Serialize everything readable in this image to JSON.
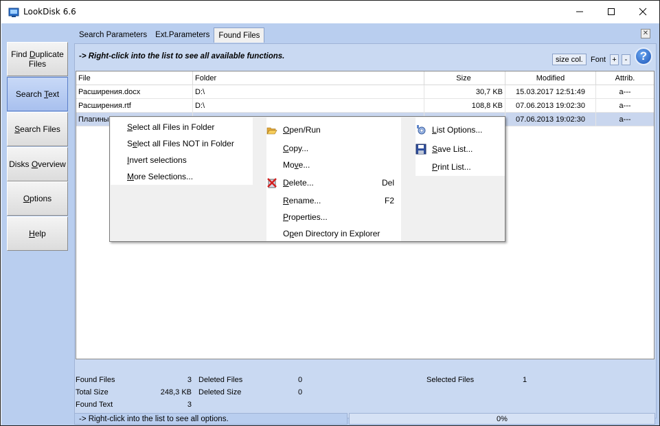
{
  "window": {
    "title": "LookDisk 6.6",
    "controls": {
      "minimize": "—",
      "maximize": "☐",
      "close": "✕"
    }
  },
  "sidebar": {
    "buttons": [
      {
        "label": "Find Duplicate Files",
        "pre": "Find ",
        "u": "D",
        "post": "uplicate Files"
      },
      {
        "label": "Search Text",
        "pre": "Search ",
        "u": "T",
        "post": "ext",
        "active": true
      },
      {
        "label": "Search Files",
        "pre": "",
        "u": "S",
        "post": "earch Files"
      },
      {
        "label": "Disks Overview",
        "pre": "Disks ",
        "u": "O",
        "post": "verview"
      },
      {
        "label": "Options",
        "pre": "",
        "u": "O",
        "post": "ptions"
      },
      {
        "label": "Help",
        "pre": "",
        "u": "H",
        "post": "elp"
      }
    ]
  },
  "tabs": [
    "Search Parameters",
    "Ext.Parameters",
    "Found Files"
  ],
  "active_tab": "Found Files",
  "toolbar": {
    "hint": "-> Right-click into the list to see all available functions.",
    "size_col": "size col.",
    "font": "Font",
    "plus": "+",
    "minus": "-",
    "help": "?"
  },
  "list": {
    "columns": [
      "File",
      "Folder",
      "Size",
      "Modified",
      "Attrib."
    ],
    "rows": [
      {
        "file": "Расширения.docx",
        "folder": "D:\\",
        "size": "30,7 KB",
        "modified": "15.03.2017 12:51:49",
        "attrib": "a---"
      },
      {
        "file": "Расширения.rtf",
        "folder": "D:\\",
        "size": "108,8 KB",
        "modified": "07.06.2013 19:02:30",
        "attrib": "a---"
      },
      {
        "file": "Плагины.",
        "folder": "",
        "size": "",
        "modified": "07.06.2013 19:02:30",
        "attrib": "a---",
        "selected": true
      }
    ]
  },
  "context_menu": {
    "col1": [
      {
        "pre": "",
        "u": "S",
        "post": "elect all Files in Folder"
      },
      {
        "pre": "S",
        "u": "e",
        "post": "lect all Files NOT in Folder"
      },
      {
        "pre": "",
        "u": "I",
        "post": "nvert selections"
      },
      {
        "pre": "",
        "u": "M",
        "post": "ore Selections..."
      }
    ],
    "col2": [
      {
        "pre": "",
        "u": "O",
        "post": "pen/Run",
        "icon": "folder-open-icon",
        "shortcut": ""
      },
      {
        "pre": "",
        "u": "C",
        "post": "opy...",
        "icon": "",
        "shortcut": ""
      },
      {
        "pre": "Mo",
        "u": "v",
        "post": "e...",
        "icon": "",
        "shortcut": ""
      },
      {
        "pre": "",
        "u": "D",
        "post": "elete...",
        "icon": "delete-icon",
        "shortcut": "Del"
      },
      {
        "pre": "",
        "u": "R",
        "post": "ename...",
        "icon": "",
        "shortcut": "F2"
      },
      {
        "pre": "",
        "u": "P",
        "post": "roperties...",
        "icon": "",
        "shortcut": ""
      },
      {
        "pre": "O",
        "u": "p",
        "post": "en Directory in Explorer",
        "icon": "",
        "shortcut": ""
      }
    ],
    "col3": [
      {
        "pre": "",
        "u": "L",
        "post": "ist Options...",
        "icon": "list-options-icon"
      },
      {
        "pre": "",
        "u": "S",
        "post": "ave List...",
        "icon": "save-icon"
      },
      {
        "pre": "",
        "u": "P",
        "post": "rint List...",
        "icon": ""
      }
    ]
  },
  "stats": {
    "found_files_label": "Found Files",
    "found_files": "3",
    "total_size_label": "Total Size",
    "total_size": "248,3 KB",
    "found_text_label": "Found Text",
    "found_text": "3",
    "deleted_files_label": "Deleted Files",
    "deleted_files": "0",
    "deleted_size_label": "Deleted Size",
    "deleted_size": "0",
    "selected_files_label": "Selected Files",
    "selected_files": "1"
  },
  "statusbar": {
    "left": "-> Right-click into the list to see all options.",
    "progress": "0%"
  }
}
